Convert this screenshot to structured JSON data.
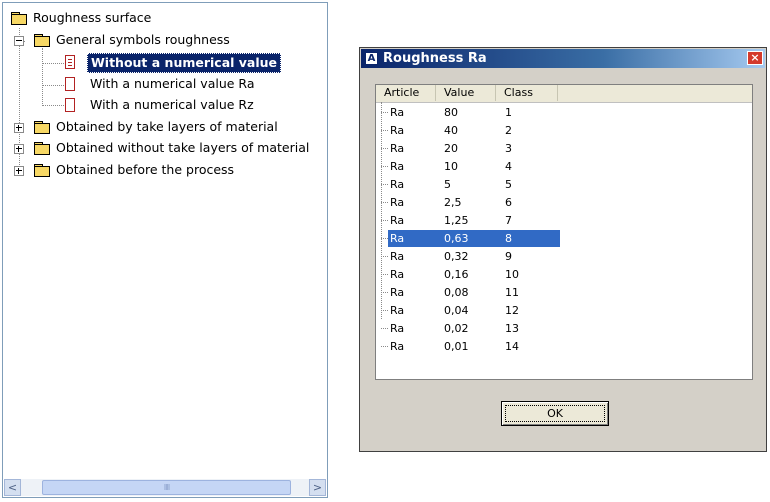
{
  "tree": {
    "root": {
      "label": "Roughness surface"
    },
    "general": {
      "label": "General symbols roughness"
    },
    "children": [
      {
        "label": "Without a numerical value"
      },
      {
        "label": "With a numerical value Ra"
      },
      {
        "label": "With a numerical value Rz"
      }
    ],
    "others": [
      {
        "label": "Obtained by take layers of material"
      },
      {
        "label": "Obtained without take layers of material"
      },
      {
        "label": "Obtained before the process"
      }
    ],
    "scrollbar": {
      "left_arrow": "<",
      "right_arrow": ">",
      "thumb_grip": "IIII"
    }
  },
  "dialog": {
    "title": "Roughness Ra",
    "close": "×",
    "columns": [
      "Article",
      "Value",
      "Class"
    ],
    "rows": [
      {
        "article": "Ra",
        "value": "80",
        "class": "1"
      },
      {
        "article": "Ra",
        "value": "40",
        "class": "2"
      },
      {
        "article": "Ra",
        "value": "20",
        "class": "3"
      },
      {
        "article": "Ra",
        "value": "10",
        "class": "4"
      },
      {
        "article": "Ra",
        "value": "5",
        "class": "5"
      },
      {
        "article": "Ra",
        "value": "2,5",
        "class": "6"
      },
      {
        "article": "Ra",
        "value": "1,25",
        "class": "7"
      },
      {
        "article": "Ra",
        "value": "0,63",
        "class": "8"
      },
      {
        "article": "Ra",
        "value": "0,32",
        "class": "9"
      },
      {
        "article": "Ra",
        "value": "0,16",
        "class": "10"
      },
      {
        "article": "Ra",
        "value": "0,08",
        "class": "11"
      },
      {
        "article": "Ra",
        "value": "0,04",
        "class": "12"
      },
      {
        "article": "Ra",
        "value": "0,02",
        "class": "13"
      },
      {
        "article": "Ra",
        "value": "0,01",
        "class": "14"
      }
    ],
    "selected_row": 7,
    "ok_label": "OK"
  },
  "colors": {
    "selection": "#316ac5",
    "tree_selection": "#0a246a",
    "folder": "#f7d865"
  }
}
